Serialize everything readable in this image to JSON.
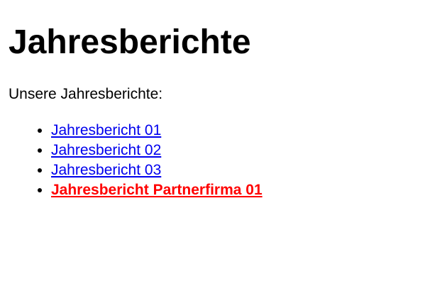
{
  "heading": "Jahresberichte",
  "intro": "Unsere Jahresberichte:",
  "reports": [
    {
      "label": "Jahresbericht 01"
    },
    {
      "label": "Jahresbericht 02"
    },
    {
      "label": "Jahresbericht 03"
    },
    {
      "label": "Jahresbericht Partnerfirma 01"
    }
  ],
  "colors": {
    "link": "#0000ee",
    "highlight_link": "#ff0000",
    "text": "#000000",
    "background": "#ffffff"
  }
}
